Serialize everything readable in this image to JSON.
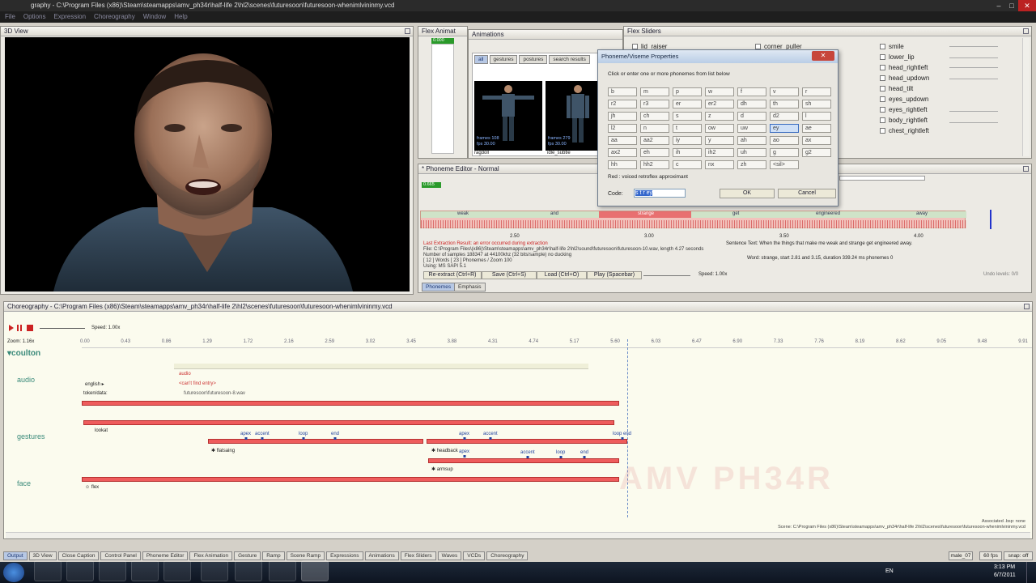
{
  "window": {
    "logo": "19",
    "title": "graphy - C:\\Program Files (x86)\\Steam\\steamapps\\amv_ph34r\\half-life 2\\hl2\\scenes\\futuresoon\\futuresoon-whenimlvininmy.vcd"
  },
  "menu": [
    "File",
    "Options",
    "Expression",
    "Choreography",
    "Window",
    "Help"
  ],
  "view3d": {
    "title": "3D View"
  },
  "flex_anim": {
    "title": "Flex Animat",
    "value": "0.000"
  },
  "animations": {
    "title": "Animations",
    "tabs": [
      "all",
      "gestures",
      "postures",
      "search results"
    ],
    "items": [
      {
        "frames": "frames 108",
        "fps": "fps 30.00",
        "name": "ragdoll"
      },
      {
        "frames": "frames 279",
        "fps": "fps 30.00",
        "name": "idle_subtle"
      }
    ]
  },
  "flex_sliders": {
    "title": "Flex Sliders",
    "left": [
      "lid_raiser",
      "corner_puller"
    ],
    "items": [
      "smile",
      "lower_lip",
      "head_rightleft",
      "head_updown",
      "head_tilt",
      "eyes_updown",
      "eyes_rightleft",
      "body_rightleft",
      "chest_rightleft"
    ]
  },
  "dialog": {
    "title": "Phoneme/Viseme Properties",
    "instruction": "Click or enter one or more phonemes from list below",
    "phonemes": [
      [
        "b",
        "m",
        "p",
        "w",
        "f",
        "v",
        "r"
      ],
      [
        "r2",
        "r3",
        "er",
        "er2",
        "dh",
        "th",
        "sh"
      ],
      [
        "jh",
        "ch",
        "s",
        "z",
        "d",
        "d2",
        "l"
      ],
      [
        "l2",
        "n",
        "t",
        "ow",
        "uw",
        "ey",
        "ae"
      ],
      [
        "aa",
        "aa2",
        "iy",
        "y",
        "ah",
        "ao",
        "ax"
      ],
      [
        "ax2",
        "eh",
        "ih",
        "ih2",
        "uh",
        "g",
        "g2"
      ],
      [
        "hh",
        "hh2",
        "c",
        "nx",
        "zh",
        "<sil>"
      ]
    ],
    "selected": "ey",
    "desc": "Red : voiced retroflex approximant",
    "code_label": "Code:",
    "code_value": "s t r ey",
    "ok": "OK",
    "cancel": "Cancel"
  },
  "phoneme_editor": {
    "title": "* Phoneme Editor - Normal",
    "value": "0.665",
    "words": [
      "weak",
      "and",
      "strange",
      "get",
      "engineered",
      "away"
    ],
    "ticks": [
      "2.50",
      "3.00",
      "3.50",
      "4.00"
    ],
    "log": [
      "Last Extraction Result:  an error occurred during extraction",
      "File:  C:\\Program Files\\(x86)\\Steam\\steamapps\\amv_ph34r\\half-life 2\\hl2\\sound\\futuresoon\\futuresoon-10.wav, length 4.27 seconds",
      "Number of samples 188347 at 44100khz (32 bits/sample) no ducking",
      "[ 12 ] Words  [ 23 ] Phonemes / Zoom 100",
      "Using:  MS SAPI 5.1"
    ],
    "sentence": "Sentence Text:  When the things that make me weak and strange get engineered away.",
    "word_info": "Word:  strange, start 2.81 and 3.15, duration 339.24 ms phonemes 0",
    "buttons": [
      "Re-extract (Ctrl+R)",
      "Save (Ctrl+S)",
      "Load (Ctrl+O)",
      "Play (Spacebar)"
    ],
    "speed": "Speed: 1.00x",
    "undo": "Undo levels: 0/0",
    "tabs": [
      "Phonemes",
      "Emphasis"
    ]
  },
  "choreo": {
    "title": "Choreography - C:\\Program Files (x86)\\Steam\\steamapps\\amv_ph34r\\half-life 2\\hl2\\scenes\\futuresoon\\futuresoon-whenimlvininmy.vcd",
    "speed": "Speed: 1.00x",
    "zoom": "Zoom: 1.16x",
    "ticks": [
      "0.00",
      "0.43",
      "0.86",
      "1.29",
      "1.72",
      "2.16",
      "2.59",
      "3.02",
      "3.45",
      "3.88",
      "4.31",
      "4.74",
      "5.17",
      "5.60",
      "6.03",
      "6.47",
      "6.90",
      "7.33",
      "7.76",
      "8.19",
      "8.62",
      "9.05",
      "9.48",
      "9.91"
    ],
    "actor": "coulton",
    "channels": [
      "audio",
      "gestures",
      "face"
    ],
    "audio": {
      "event": "audio",
      "lang": "english",
      "missing": "<can't find entry>",
      "token": "token/data:",
      "file": "futuresoon\\futuresoon-8.wav"
    },
    "gestures": {
      "lookat": "lookat",
      "flatsaing": "flatsaing",
      "headback": "headback",
      "armsup": "armsup",
      "m1": [
        "apex",
        "accent",
        "loop",
        "end"
      ],
      "m2": [
        "apex",
        "accent",
        "loop end"
      ],
      "m3": [
        "apex",
        "accent",
        "loop",
        "end"
      ]
    },
    "face": {
      "flex": "flex"
    },
    "assoc": "Associated .bsp: none",
    "scene": "Scene:  C:\\Program Files (x86)\\Steam\\steamapps\\amv_ph34r\\half-life 2\\hl2\\scenes\\futuresoon\\futuresoon-whenimlvininmy.vcd",
    "watermark": "AMV PH34R"
  },
  "bottom_tabs": [
    "Output",
    "3D View",
    "Close Caption",
    "Control Panel",
    "Phoneme Editor",
    "Flex Animation",
    "Gesture",
    "Ramp",
    "Scene Ramp",
    "Expressions",
    "Animations",
    "Flex Sliders",
    "Waves",
    "VCDs",
    "Choreography"
  ],
  "status_right": {
    "model": "male_07",
    "fps": "60 fps",
    "snap": "snap: off"
  },
  "taskbar": {
    "lang": "EN",
    "time": "3:13 PM",
    "date": "6/7/2011"
  }
}
